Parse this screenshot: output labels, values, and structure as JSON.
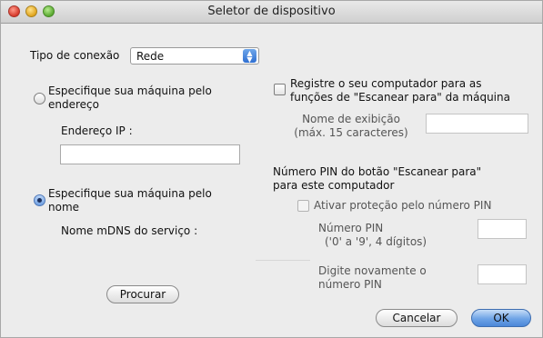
{
  "window": {
    "title": "Seletor de dispositivo"
  },
  "connection": {
    "label": "Tipo de conexão",
    "value": "Rede"
  },
  "by_address": {
    "option_label_line1": "Especifique sua máquina pelo",
    "option_label_line2": "endereço",
    "ip_label": "Endereço IP :",
    "ip_value": ""
  },
  "by_name": {
    "option_label_line1": "Especifique sua máquina pelo",
    "option_label_line2": "nome",
    "mdns_label": "Nome mDNS do serviço :"
  },
  "browse_button": "Procurar",
  "register": {
    "label_line1": "Registre o seu computador para as",
    "label_line2": "funções  de \"Escanear para\" da máquina",
    "display_name_line1": "Nome de exibição",
    "display_name_line2": "(máx. 15 caracteres)",
    "display_name_value": ""
  },
  "pin": {
    "header_line1": "Número PIN do botão \"Escanear para\"",
    "header_line2": "para este computador",
    "enable_label": "Ativar proteção pelo número PIN",
    "pin_label_line1": "Número PIN",
    "pin_label_line2": "('0' a '9', 4 dígitos)",
    "repeat_line1": "Digite novamente o",
    "repeat_line2": "número PIN"
  },
  "buttons": {
    "cancel": "Cancelar",
    "ok": "OK"
  }
}
